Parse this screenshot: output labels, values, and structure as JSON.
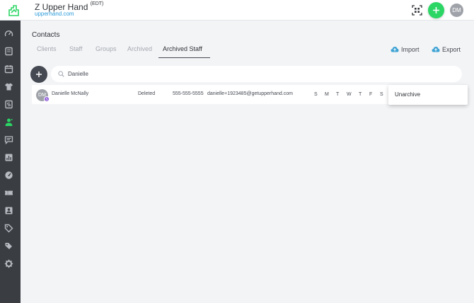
{
  "header": {
    "business_name": "Z Upper Hand",
    "timezone": "(EDT)",
    "business_url": "upperhand.com",
    "user_initials": "DM"
  },
  "sidebar": {
    "items": [
      {
        "icon": "dashboard-icon",
        "active": false
      },
      {
        "icon": "book-icon",
        "active": false
      },
      {
        "icon": "calendar-icon",
        "active": false
      },
      {
        "icon": "shirt-icon",
        "active": false
      },
      {
        "icon": "dollar-document-icon",
        "active": false
      },
      {
        "icon": "contacts-icon",
        "active": true
      },
      {
        "icon": "message-icon",
        "active": false
      },
      {
        "icon": "bar-chart-icon",
        "active": false
      },
      {
        "icon": "speedometer-icon",
        "active": false
      },
      {
        "icon": "ticket-icon",
        "active": false
      },
      {
        "icon": "badge-icon",
        "active": false
      },
      {
        "icon": "tag-icon",
        "active": false
      },
      {
        "icon": "tags-icon",
        "active": false
      },
      {
        "icon": "gear-icon",
        "active": false
      }
    ]
  },
  "page": {
    "title": "Contacts",
    "tabs": [
      {
        "label": "Clients"
      },
      {
        "label": "Staff"
      },
      {
        "label": "Groups"
      },
      {
        "label": "Archived"
      },
      {
        "label": "Archived Staff"
      }
    ],
    "active_tab": "Archived Staff",
    "import_label": "Import",
    "export_label": "Export"
  },
  "search": {
    "value": "Danielle"
  },
  "staff_row": {
    "initials": "DM",
    "badge": "S",
    "name": "Danielle McNally",
    "status": "Deleted",
    "phone": "555-555-5555",
    "email": "danielle+1923485@getupperhand.com",
    "days": [
      "S",
      "M",
      "T",
      "W",
      "T",
      "F",
      "S"
    ]
  },
  "context_menu": {
    "items": [
      {
        "label": "Unarchive"
      }
    ]
  },
  "colors": {
    "accent_green": "#2bd665",
    "sidebar_bg": "#3a3d42",
    "link_blue": "#2d9cdb",
    "cloud_blue": "#3fa3d4",
    "badge_purple": "#8a54d9"
  }
}
